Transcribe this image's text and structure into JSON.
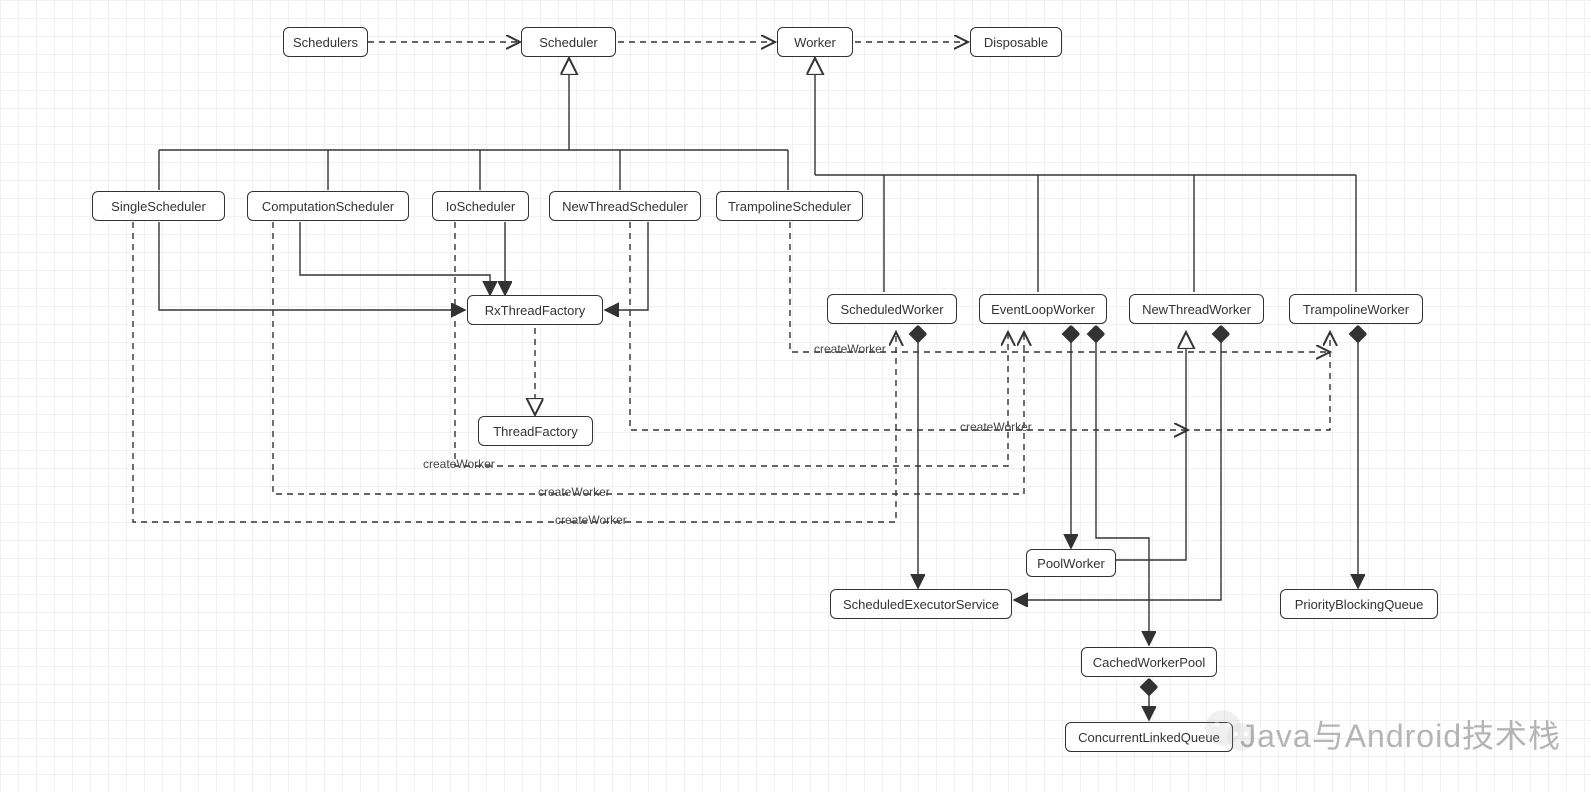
{
  "nodes": {
    "schedulers": "Schedulers",
    "scheduler": "Scheduler",
    "worker": "Worker",
    "disposable": "Disposable",
    "singleScheduler": "SingleScheduler",
    "computationScheduler": "ComputationScheduler",
    "ioScheduler": "IoScheduler",
    "newThreadScheduler": "NewThreadScheduler",
    "trampolineScheduler": "TrampolineScheduler",
    "rxThreadFactory": "RxThreadFactory",
    "threadFactory": "ThreadFactory",
    "scheduledWorker": "ScheduledWorker",
    "eventLoopWorker": "EventLoopWorker",
    "newThreadWorker": "NewThreadWorker",
    "trampolineWorker": "TrampolineWorker",
    "poolWorker": "PoolWorker",
    "scheduledExecutorService": "ScheduledExecutorService",
    "priorityBlockingQueue": "PriorityBlockingQueue",
    "cachedWorkerPool": "CachedWorkerPool",
    "concurrentLinkedQueue": "ConcurrentLinkedQueue"
  },
  "edgeLabels": {
    "createWorker": "createWorker"
  },
  "watermark": "Java与Android技术栈"
}
